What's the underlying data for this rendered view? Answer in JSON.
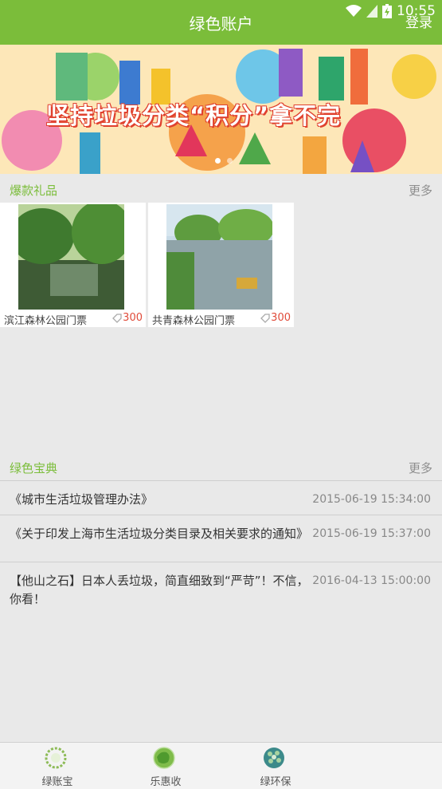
{
  "header": {
    "title": "绿色账户",
    "login": "登录",
    "status_time": "10:55",
    "accent": "#7bbd3a"
  },
  "banner": {
    "caption": "坚持垃圾分类“积分”拿不完"
  },
  "gifts": {
    "title": "爆款礼品",
    "more": "更多",
    "items": [
      {
        "name": "滨江森林公园门票",
        "points": "300"
      },
      {
        "name": "共青森林公园门票",
        "points": "300"
      }
    ]
  },
  "handbook": {
    "title": "绿色宝典",
    "more": "更多",
    "items": [
      {
        "title": "《城市生活垃圾管理办法》",
        "date": "2015-06-19 15:34:00"
      },
      {
        "title": "《关于印发上海市生活垃圾分类目录及相关要求的通知》",
        "date": "2015-06-19 15:37:00"
      },
      {
        "title": "【他山之石】日本人丢垃圾，简直细致到“严苛”！不信，你看！",
        "date": "2016-04-13 15:00:00"
      }
    ]
  },
  "nav": {
    "items": [
      {
        "label": "绿账宝",
        "icon": "wreath-icon"
      },
      {
        "label": "乐惠收",
        "icon": "globe-recycle-icon"
      },
      {
        "label": "绿环保",
        "icon": "earth-icon"
      }
    ]
  }
}
